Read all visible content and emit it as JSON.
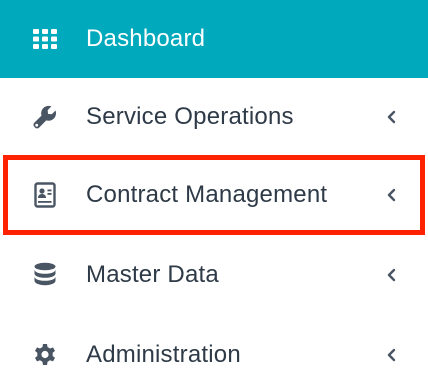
{
  "nav": {
    "items": [
      {
        "label": "Dashboard",
        "icon": "grid-icon",
        "active": true,
        "has_chevron": false
      },
      {
        "label": "Service Operations",
        "icon": "wrench-icon",
        "active": false,
        "has_chevron": true
      },
      {
        "label": "Contract Management",
        "icon": "contract-icon",
        "active": false,
        "has_chevron": true,
        "highlighted": true
      },
      {
        "label": "Master Data",
        "icon": "database-icon",
        "active": false,
        "has_chevron": true
      },
      {
        "label": "Administration",
        "icon": "gear-icon",
        "active": false,
        "has_chevron": true
      }
    ]
  },
  "colors": {
    "active_bg": "#00a9bb",
    "text": "#2e3a47",
    "icon": "#4a5563",
    "highlight": "#ff2200"
  }
}
